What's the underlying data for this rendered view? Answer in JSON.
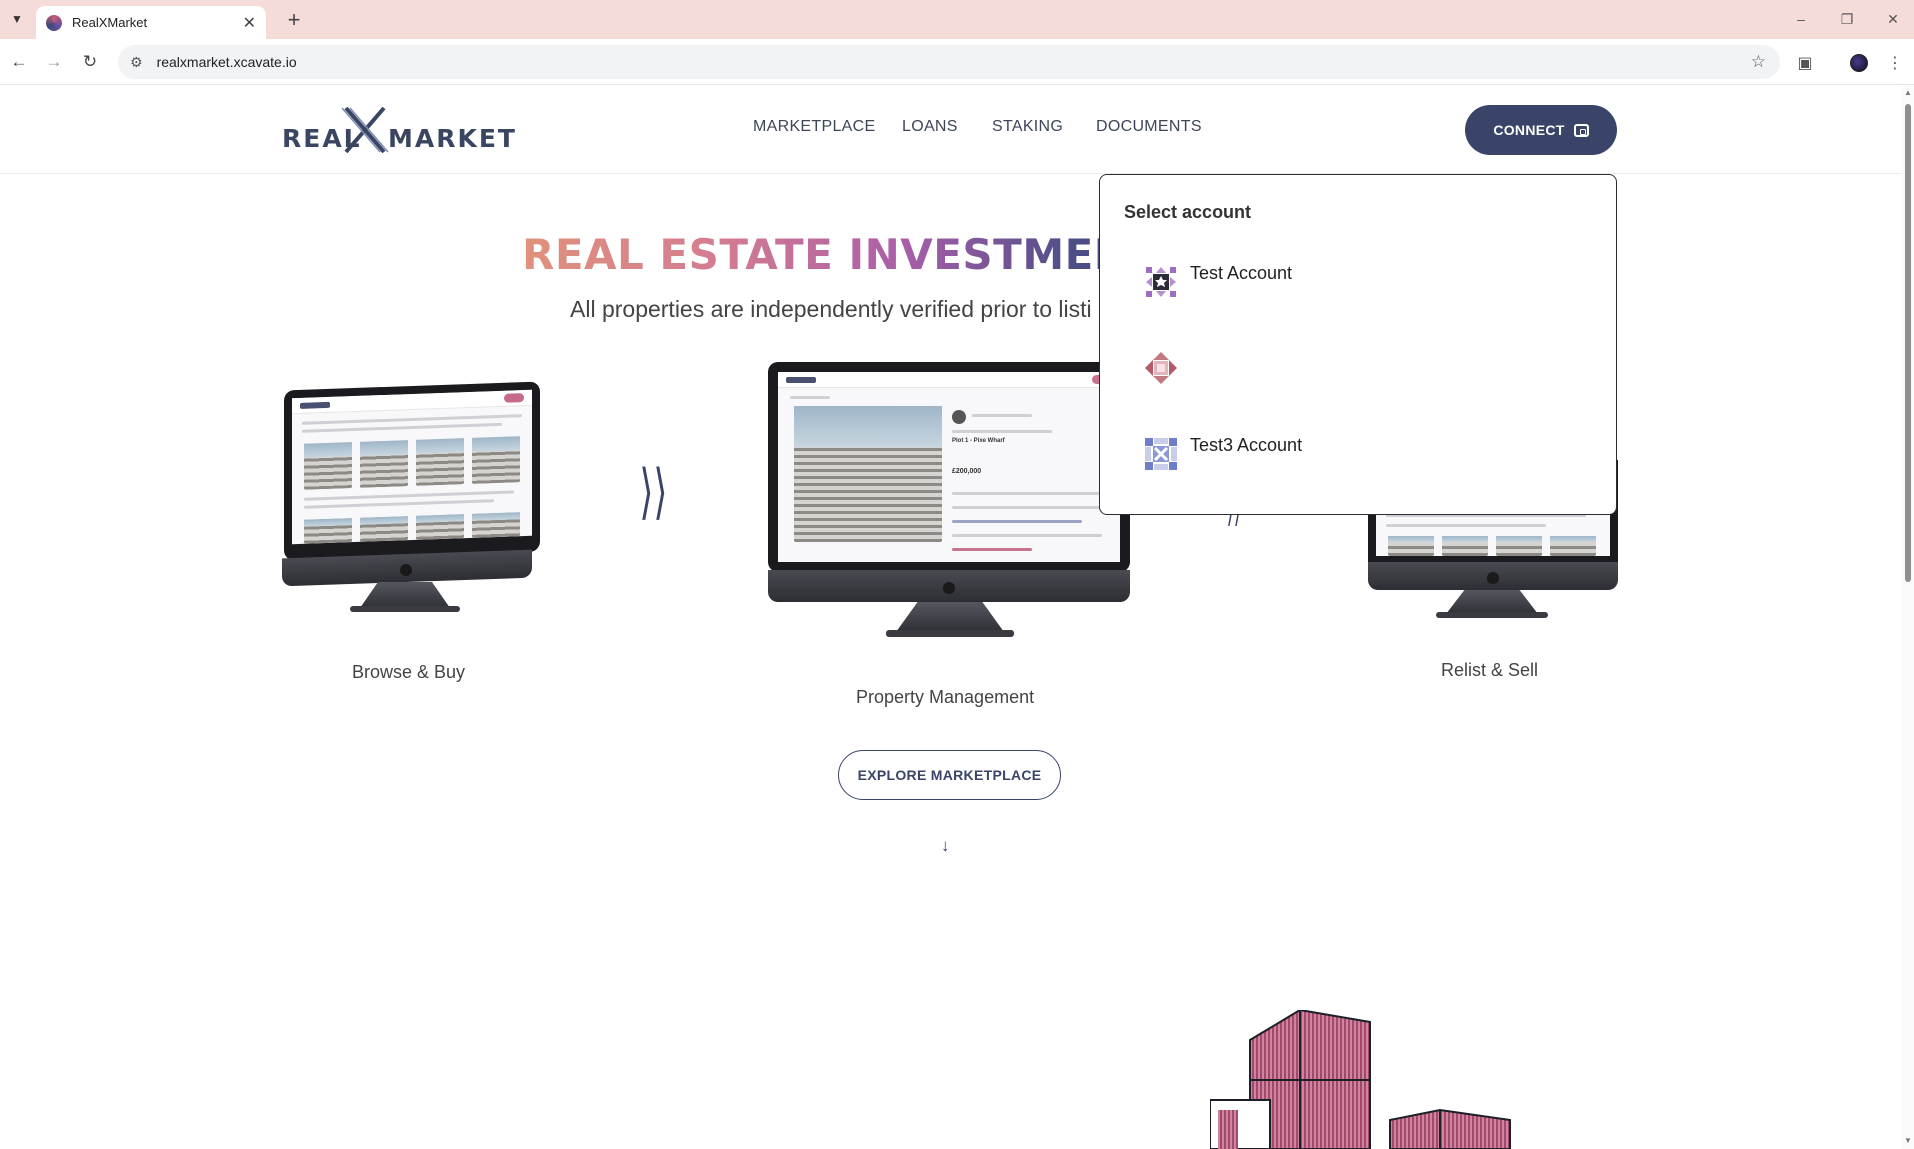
{
  "browser": {
    "tab_title": "RealXMarket",
    "url": "realxmarket.xcavate.io"
  },
  "site": {
    "logo_left": "REAL",
    "logo_right": "MARKET",
    "nav": [
      "MARKETPLACE",
      "LOANS",
      "STAKING",
      "DOCUMENTS"
    ],
    "connect_label": "CONNECT"
  },
  "hero": {
    "title": "REAL ESTATE INVESTMENT M",
    "subtitle": "All properties are independently verified prior to listi"
  },
  "steps": {
    "browse": "Browse & Buy",
    "manage": "Property Management",
    "relist": "Relist & Sell",
    "mini_price": "£200,000",
    "mini_plot": "Plot 1 - Pixe Wharf"
  },
  "explore_label": "EXPLORE MARKETPLACE",
  "dropdown": {
    "heading": "Select account",
    "accounts": [
      {
        "name": "Test Account",
        "icon": "identicon-purple-star"
      },
      {
        "name": "",
        "icon": "identicon-red-diamond"
      },
      {
        "name": "Test3 Account",
        "icon": "identicon-blue-cross"
      }
    ]
  },
  "colors": {
    "accent": "#3a4468",
    "gradient_start": "#e0927c",
    "gradient_end": "#3a3f6e"
  }
}
